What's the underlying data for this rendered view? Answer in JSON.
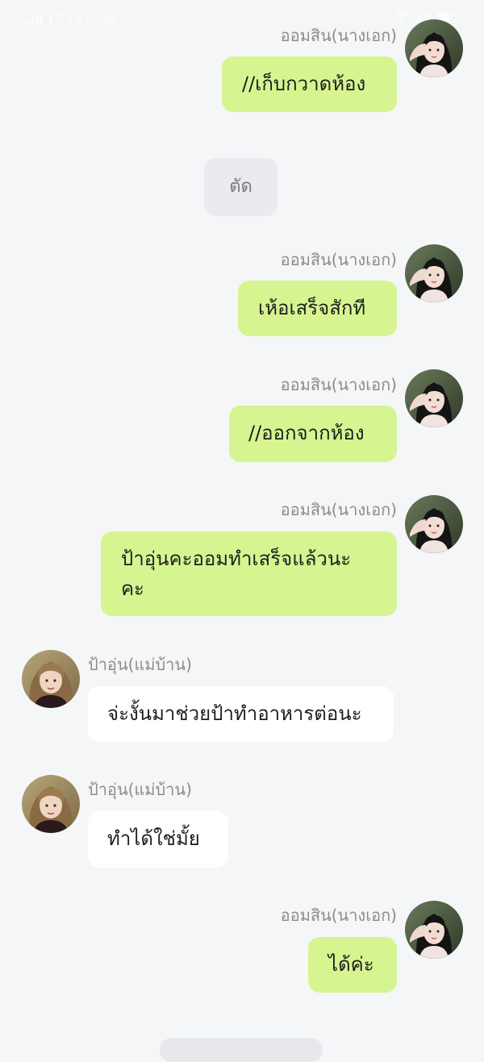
{
  "status_bar": {
    "time": "17:15 น.",
    "extra": "46",
    "battery": "29"
  },
  "characters": {
    "heroine": "ออมสิน(นางเอก)",
    "maid": "ป้าอุ่น(แม่บ้าน)"
  },
  "messages": [
    {
      "sender": "ออมสิน(นางเอก)",
      "side": "right",
      "text": "//เก็บกวาดห้อง"
    },
    {
      "sender": "",
      "side": "center",
      "text": "ตัด"
    },
    {
      "sender": "ออมสิน(นางเอก)",
      "side": "right",
      "text": "เห้อเสร็จสักที"
    },
    {
      "sender": "ออมสิน(นางเอก)",
      "side": "right",
      "text": "//ออกจากห้อง"
    },
    {
      "sender": "ออมสิน(นางเอก)",
      "side": "right",
      "text": "ป้าอุ่นคะออมทำเสร็จแล้วนะคะ"
    },
    {
      "sender": "ป้าอุ่น(แม่บ้าน)",
      "side": "left",
      "text": "จ่ะงั้นมาช่วยป้าทำอาหารต่อนะ"
    },
    {
      "sender": "ป้าอุ่น(แม่บ้าน)",
      "side": "left",
      "text": "ทำได้ใช่มั้ย"
    },
    {
      "sender": "ออมสิน(นางเอก)",
      "side": "right",
      "text": "ได้ค่ะ"
    }
  ],
  "message_lines": {
    "m5_line1": "ป้าอุ่นคะออมทำเสร็จแล้วนะ",
    "m5_line2": "คะ"
  },
  "colors": {
    "bubble_self": "#d6f590",
    "bubble_other": "#ffffff",
    "bubble_system": "#e9ebee",
    "background": "#f5f6f8",
    "name_text": "#8c8c8c"
  }
}
